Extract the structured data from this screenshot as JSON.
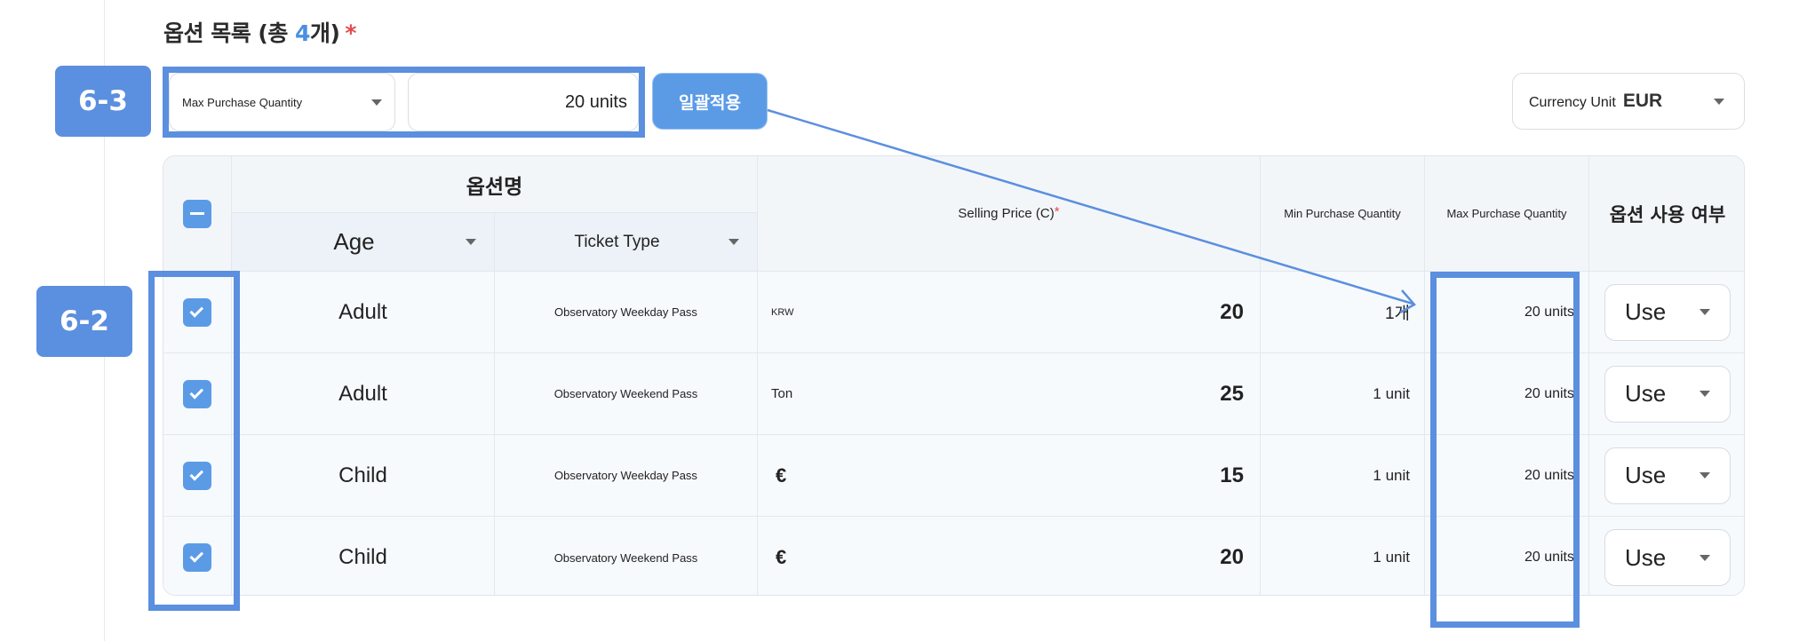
{
  "section": {
    "title_prefix": "옵션 목록 (총 ",
    "count": "4",
    "title_suffix": "개)",
    "required_mark": "*"
  },
  "callouts": {
    "bulk": "6-3",
    "checkbox_col": "6-2"
  },
  "bulk_edit": {
    "field_label": "Max Purchase Quantity",
    "quantity_value": "20 units",
    "apply_label": "일괄적용"
  },
  "currency": {
    "label": "Currency Unit",
    "value": "EUR"
  },
  "table": {
    "headers": {
      "option_name": "옵션명",
      "age": "Age",
      "ticket_type": "Ticket Type",
      "selling_price": "Selling Price (C)",
      "selling_price_required": "*",
      "min_qty": "Min Purchase Quantity",
      "max_qty": "Max Purchase Quantity",
      "use_status": "옵션 사용 여부"
    },
    "rows": [
      {
        "age": "Adult",
        "ticket": "Observatory Weekday Pass",
        "currency": "KRW",
        "price": "20",
        "min": "1개",
        "max": "20 units",
        "use": "Use"
      },
      {
        "age": "Adult",
        "ticket": "Observatory Weekend Pass",
        "currency": "Ton",
        "price": "25",
        "min": "1 unit",
        "max": "20 units",
        "use": "Use"
      },
      {
        "age": "Child",
        "ticket": "Observatory Weekday Pass",
        "currency": "€",
        "price": "15",
        "min": "1 unit",
        "max": "20 units",
        "use": "Use"
      },
      {
        "age": "Child",
        "ticket": "Observatory Weekend Pass",
        "currency": "€",
        "price": "20",
        "min": "1 unit",
        "max": "20 units",
        "use": "Use"
      }
    ]
  },
  "colors": {
    "accent": "#5b8fdf",
    "button": "#5b9be6",
    "required": "#e5484d"
  }
}
